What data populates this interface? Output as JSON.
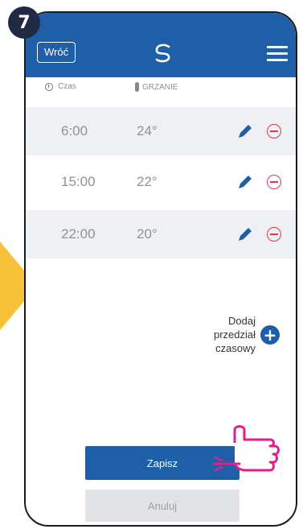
{
  "step": {
    "number": "7"
  },
  "header": {
    "back_label": "Wróć"
  },
  "columns": {
    "time_label": "Czas",
    "temp_label": "GRZANIE"
  },
  "schedule": [
    {
      "time": "6:00",
      "temp": "24°"
    },
    {
      "time": "15:00",
      "temp": "22°"
    },
    {
      "time": "22:00",
      "temp": "20°"
    }
  ],
  "add_slot": {
    "label_line1": "Dodaj",
    "label_line2": "przedział",
    "label_line3": "czasowy"
  },
  "actions": {
    "save_label": "Zapisz",
    "cancel_label": "Anuluj"
  },
  "colors": {
    "brand_blue": "#1f5fa8",
    "remove_red": "#d83a4f",
    "accent_yellow": "#f7c23a",
    "tap_magenta": "#e21f8a"
  },
  "icons": {
    "logo": "logo-icon",
    "menu": "hamburger-menu-icon",
    "time": "clock-icon",
    "temp": "thermometer-icon",
    "edit": "pencil-icon",
    "remove": "minus-circle-icon",
    "add": "plus-circle-icon",
    "tap": "tap-hand-icon",
    "pointer": "arrow-right-icon"
  }
}
